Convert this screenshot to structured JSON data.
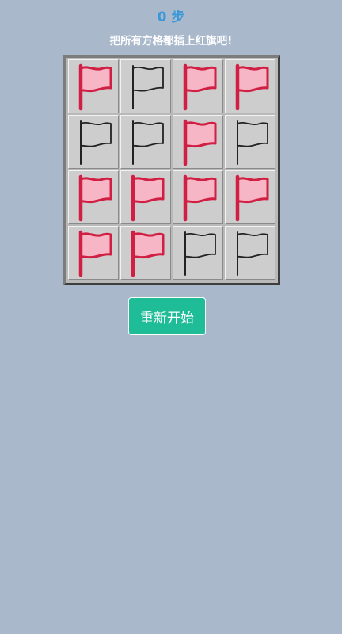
{
  "header": {
    "steps_text": "0 步",
    "hint": "把所有方格都插上红旗吧!"
  },
  "board": {
    "rows": 4,
    "cols": 4,
    "cells": [
      [
        "red",
        "empty",
        "red",
        "red"
      ],
      [
        "empty",
        "empty",
        "red",
        "empty"
      ],
      [
        "red",
        "red",
        "red",
        "red"
      ],
      [
        "red",
        "red",
        "empty",
        "empty"
      ]
    ],
    "icons": {
      "red": "red-flag-icon",
      "empty": "empty-flag-icon"
    }
  },
  "controls": {
    "restart_label": "重新开始"
  },
  "colors": {
    "background": "#a9b9cb",
    "steps_text": "#3b98d8",
    "hint_text": "#ffffff",
    "flag_red_fill": "#f6b6c6",
    "flag_red_stroke": "#d01f43",
    "flag_empty_stroke": "#222222",
    "restart_button": "#1fbc98"
  }
}
